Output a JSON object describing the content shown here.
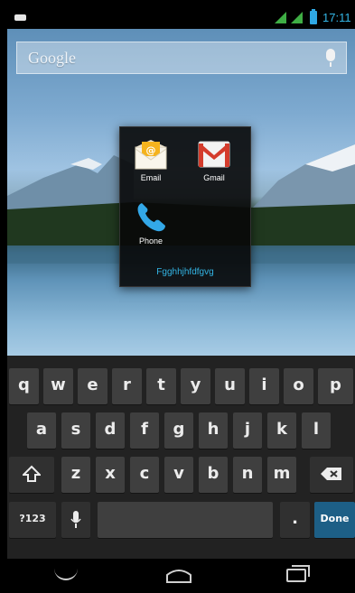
{
  "status_bar": {
    "time": "17:11"
  },
  "search_bar": {
    "label": "Google"
  },
  "folder": {
    "name": "Fgghhjhfdfgvg",
    "apps": [
      {
        "label": "Email",
        "icon": "email-icon"
      },
      {
        "label": "Gmail",
        "icon": "gmail-icon"
      },
      {
        "label": "Phone",
        "icon": "phone-icon"
      }
    ]
  },
  "keyboard": {
    "row1": [
      "q",
      "w",
      "e",
      "r",
      "t",
      "y",
      "u",
      "i",
      "o",
      "p"
    ],
    "row2": [
      "a",
      "s",
      "d",
      "f",
      "g",
      "h",
      "j",
      "k",
      "l"
    ],
    "row3": [
      "z",
      "x",
      "c",
      "v",
      "b",
      "n",
      "m"
    ],
    "symbols_label": "?123",
    "period_label": ".",
    "done_label": "Done",
    "accent_color": "#1d5f86"
  },
  "nav_bar": {
    "icons": [
      "back-icon",
      "home-icon",
      "recents-icon"
    ]
  }
}
